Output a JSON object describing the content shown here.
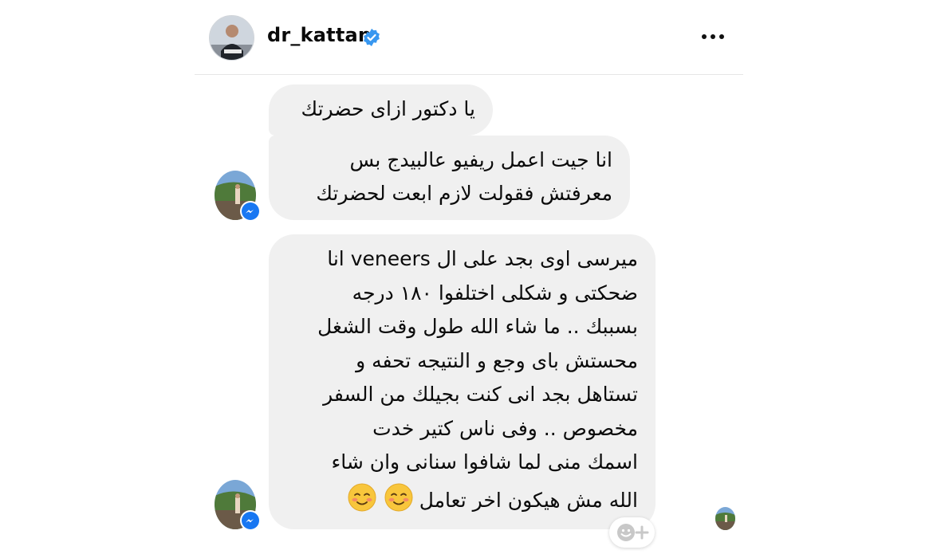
{
  "header": {
    "username": "dr_kattan",
    "verified": true,
    "more_icon": "more-horizontal-icon"
  },
  "messages": [
    {
      "lines": [
        "يا دكتور ازاى حضرتك"
      ]
    },
    {
      "lines": [
        "انا جيت اعمل ريفيو عالبيدج بس",
        "معرفتش فقولت لازم ابعت لحضرتك"
      ]
    },
    {
      "lines": [
        "ميرسى اوى بجد على ال veneers انا",
        "ضحكتى و شكلى اختلفوا ١٨٠ درجه",
        "بسببك .. ما شاء الله طول وقت الشغل",
        "محستش باى وجع و النتيجه تحفه و",
        "تستاهل بجد انى كنت بجيلك من السفر",
        "مخصوص .. وفى ناس كتير خدت",
        "اسمك منى لما شافوا سنانى وان شاء",
        "الله مش هيكون اخر تعامل"
      ],
      "emoji": "☺️☺️"
    }
  ],
  "icons": {
    "messenger_badge": "messenger-icon",
    "reaction": "add-reaction-icon"
  },
  "colors": {
    "bubble_bg": "#f0f0f0",
    "verified_blue": "#3897f0",
    "messenger_blue": "#1877f2"
  }
}
